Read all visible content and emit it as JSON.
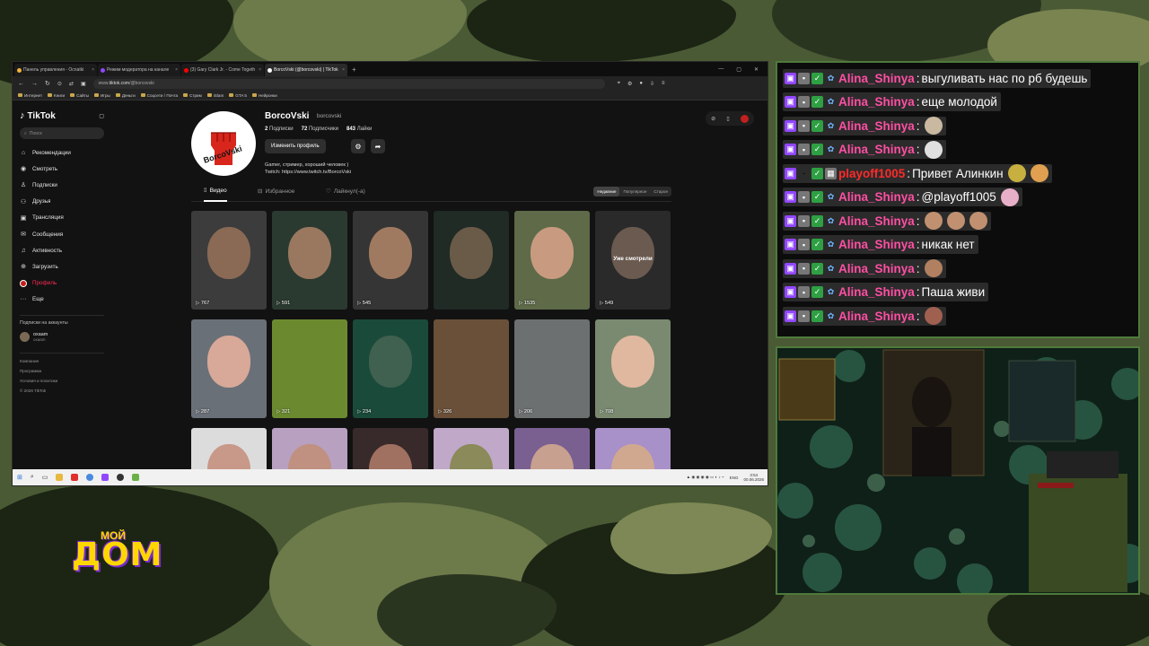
{
  "browser": {
    "tabs": [
      {
        "label": "Панель управления - Ocnatki",
        "color": "#f0b43c",
        "active": false
      },
      {
        "label": "Режим модератора на канале",
        "color": "#9147ff",
        "active": false
      },
      {
        "label": "(3) Gary Clark Jr. - Come Togeth",
        "color": "#ff0000",
        "active": false
      },
      {
        "label": "BorcoVski (@borcovski) | TikTok",
        "color": "#ffffff",
        "active": true
      }
    ],
    "new_tab": "+",
    "url_prefix": "www.",
    "url_domain": "tiktok.com",
    "url_path": "/@borcovski",
    "bookmarks": [
      "Интернет",
      "Книги",
      "Сайты",
      "Игры",
      "Деньги",
      "Соцсети / Почта",
      "Стрим",
      "iSlam",
      "GTA 5",
      "Нейронки"
    ]
  },
  "tiktok": {
    "logo": "TikTok",
    "search_placeholder": "Поиск",
    "nav": [
      {
        "label": "Рекомендации",
        "icon": "home-icon",
        "glyph": "⌂"
      },
      {
        "label": "Смотреть",
        "icon": "compass-icon",
        "glyph": "◉"
      },
      {
        "label": "Подписки",
        "icon": "user-icon",
        "glyph": "♙"
      },
      {
        "label": "Друзья",
        "icon": "friends-icon",
        "glyph": "⚇"
      },
      {
        "label": "Трансляция",
        "icon": "live-icon",
        "glyph": "▣"
      },
      {
        "label": "Сообщения",
        "icon": "message-icon",
        "glyph": "✉"
      },
      {
        "label": "Активность",
        "icon": "bell-icon",
        "glyph": "♫"
      },
      {
        "label": "Загрузить",
        "icon": "upload-icon",
        "glyph": "⊕"
      },
      {
        "label": "Профиль",
        "icon": "profile-icon",
        "glyph": "●"
      },
      {
        "label": "Еще",
        "icon": "more-icon",
        "glyph": "···"
      }
    ],
    "following_header": "Подписки на аккаунты",
    "following": {
      "name": "oxaam",
      "sub": "oxaam"
    },
    "footer": [
      "Компания",
      "Программа",
      "Условия и политики",
      "© 2026 TikTok"
    ],
    "profile": {
      "display_name": "BorcoVski",
      "username": "borcovski",
      "following_count": "2",
      "following_label": "Подписки",
      "followers_count": "72",
      "followers_label": "Подписчики",
      "likes_count": "843",
      "likes_label": "Лайки",
      "edit_button": "Изменить профиль",
      "bio_line1": "Gamer, стример, хороший человек )",
      "bio_line2": "Twitch: https://www.twitch.tv/BorcoVski",
      "avatar_text": "BorcoVski"
    },
    "tabs": [
      "Видео",
      "Избранное",
      "Лайкнул(-а)"
    ],
    "sort": [
      "Недавние",
      "Популярное",
      "Старое"
    ],
    "videos": [
      {
        "views": "767",
        "bg": "#3c3c3c",
        "face": "#8a6a55"
      },
      {
        "views": "591",
        "bg": "#2b3a30",
        "face": "#9a7860"
      },
      {
        "views": "545",
        "bg": "#353535",
        "face": "#a07a60"
      },
      {
        "views": "",
        "bg": "#1f2b24",
        "face": "#6a5a48"
      },
      {
        "views": "1535",
        "bg": "#5e6a48",
        "face": "#c89a80"
      },
      {
        "views": "549",
        "bg": "#2a2a2a",
        "face": "#6a5a50",
        "label": "Уже смотрели"
      },
      {
        "views": "287",
        "bg": "#6a7078",
        "face": "#d8a898"
      },
      {
        "views": "321",
        "bg": "#6b8a30",
        "face": ""
      },
      {
        "views": "234",
        "bg": "#1a4a3a",
        "face": "#406050"
      },
      {
        "views": "326",
        "bg": "#6a5038",
        "face": ""
      },
      {
        "views": "206",
        "bg": "#6c7070",
        "face": ""
      },
      {
        "views": "708",
        "bg": "#7a8a70",
        "face": "#e0b8a0"
      },
      {
        "views": "",
        "bg": "#dcdcdc",
        "face": "#c89888"
      },
      {
        "views": "",
        "bg": "#b8a0c0",
        "face": "#c09080"
      },
      {
        "views": "",
        "bg": "#382a2a",
        "face": "#a07060"
      },
      {
        "views": "",
        "bg": "#c0a8c8",
        "face": "#8a8a5a"
      },
      {
        "views": "",
        "bg": "#7a6090",
        "face": "#c8a090"
      },
      {
        "views": "",
        "bg": "#a890c8",
        "face": "#d0a890"
      }
    ]
  },
  "taskbar": {
    "lang": "ENG",
    "time": "3:54",
    "date": "00.06.2026"
  },
  "chat": {
    "messages": [
      {
        "user": "Alina_Shinya",
        "text": "выгуливать нас по рб будешь",
        "red": false,
        "emotes": []
      },
      {
        "user": "Alina_Shinya",
        "text": "еще молодой",
        "red": false,
        "emotes": []
      },
      {
        "user": "Alina_Shinya",
        "text": "",
        "red": false,
        "emotes": [
          "#c9b9a0"
        ]
      },
      {
        "user": "Alina_Shinya",
        "text": "",
        "red": false,
        "emotes": [
          "#e0e0e0"
        ]
      },
      {
        "user": "playoff1005",
        "text": "Привет Алинкин",
        "red": true,
        "emotes": [
          "#c8b040",
          "#e0a050"
        ]
      },
      {
        "user": "Alina_Shinya",
        "text": "@playoff1005",
        "red": false,
        "emotes": [
          "#e8b0c8"
        ]
      },
      {
        "user": "Alina_Shinya",
        "text": "",
        "red": false,
        "emotes": [
          "#c09070",
          "#c09070",
          "#c09070"
        ]
      },
      {
        "user": "Alina_Shinya",
        "text": "никак нет",
        "red": false,
        "emotes": []
      },
      {
        "user": "Alina_Shinya",
        "text": "",
        "red": false,
        "emotes": [
          "#b08060"
        ]
      },
      {
        "user": "Alina_Shinya",
        "text": "Паша живи",
        "red": false,
        "emotes": []
      },
      {
        "user": "Alina_Shinya",
        "text": "",
        "red": false,
        "emotes": [
          "#a06050"
        ]
      }
    ]
  },
  "overlay_logo": {
    "top": "МОЙ",
    "bottom": "ДОМ"
  }
}
